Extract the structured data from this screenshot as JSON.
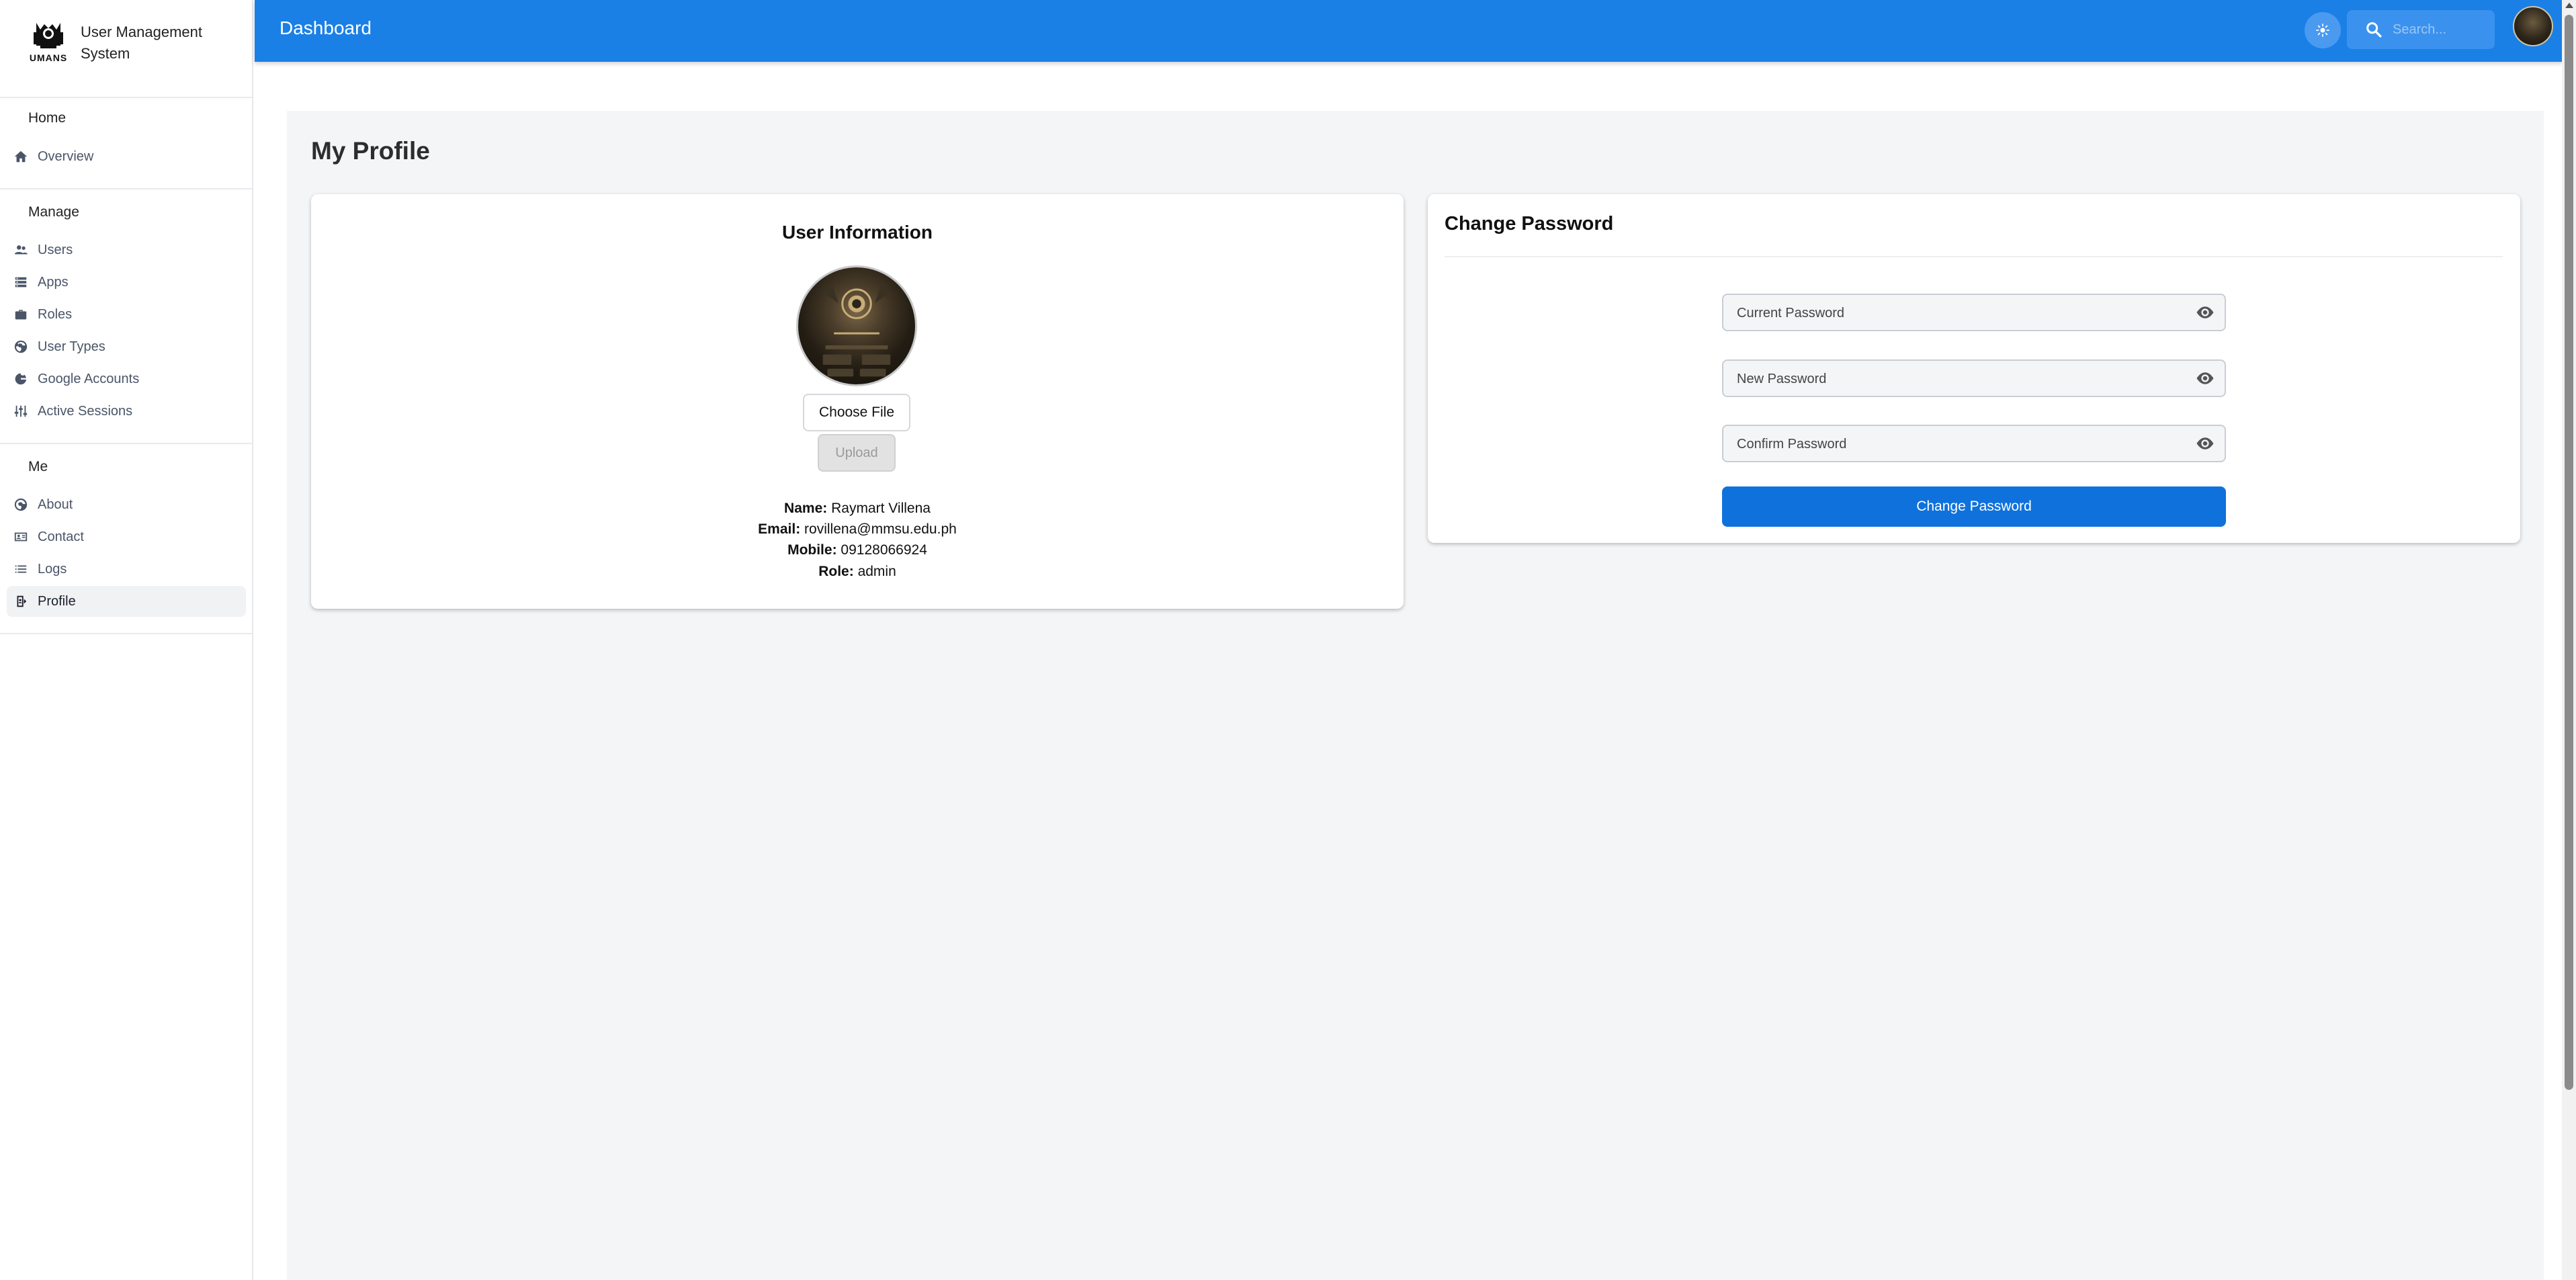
{
  "brand": {
    "logo_text": "UMANS",
    "title": "User Management System"
  },
  "sidebar": {
    "sections": [
      {
        "label": "Home",
        "items": [
          {
            "label": "Overview",
            "icon": "home-icon"
          }
        ]
      },
      {
        "label": "Manage",
        "items": [
          {
            "label": "Users",
            "icon": "users-icon"
          },
          {
            "label": "Apps",
            "icon": "apps-icon"
          },
          {
            "label": "Roles",
            "icon": "briefcase-icon"
          },
          {
            "label": "User Types",
            "icon": "globe-icon"
          },
          {
            "label": "Google Accounts",
            "icon": "google-icon"
          },
          {
            "label": "Active Sessions",
            "icon": "sliders-icon"
          }
        ]
      },
      {
        "label": "Me",
        "items": [
          {
            "label": "About",
            "icon": "info-icon"
          },
          {
            "label": "Contact",
            "icon": "contact-card-icon"
          },
          {
            "label": "Logs",
            "icon": "list-icon"
          },
          {
            "label": "Profile",
            "icon": "profile-icon",
            "active": true
          }
        ]
      }
    ]
  },
  "topbar": {
    "title": "Dashboard",
    "search_placeholder": "Search..."
  },
  "page": {
    "title": "My Profile"
  },
  "user_info": {
    "title": "User Information",
    "choose_file": "Choose File",
    "upload": "Upload",
    "name_label": "Name:",
    "name": "Raymart Villena",
    "email_label": "Email:",
    "email": "rovillena@mmsu.edu.ph",
    "mobile_label": "Mobile:",
    "mobile": "09128066924",
    "role_label": "Role:",
    "role": "admin"
  },
  "change_password": {
    "title": "Change Password",
    "current_placeholder": "Current Password",
    "new_placeholder": "New Password",
    "confirm_placeholder": "Confirm Password",
    "button": "Change Password"
  },
  "colors": {
    "topbar": "#1a80e6",
    "primary_button": "#0f72dc",
    "page_bg": "#f4f5f7"
  }
}
